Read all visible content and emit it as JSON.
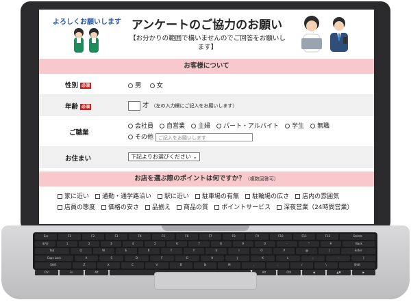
{
  "header": {
    "tagline": "よろしくお願いします",
    "title": "アンケートのご協力のお願い",
    "subtitle": "【お分かりの範囲で構いませんのでご回答をお願いします】"
  },
  "section_customer": {
    "title": "お客様について"
  },
  "gender": {
    "label": "性別",
    "required": "必須",
    "options": [
      "男",
      "女"
    ]
  },
  "age": {
    "label": "年齢",
    "required": "必須",
    "unit": "才",
    "note": "（左の入力欄にご記入をお願いします）"
  },
  "occupation": {
    "label": "ご職業",
    "options": [
      "会社員",
      "自営業",
      "主婦",
      "パート・アルバイト",
      "学生",
      "無職"
    ],
    "other_label": "その他",
    "other_placeholder": "ご記入をお願いします"
  },
  "address": {
    "label": "お住まい",
    "select_value": "下記よりお選びください"
  },
  "section_points": {
    "title": "お店を選ぶ際のポイントは何ですか？",
    "note": "（複数回答可）"
  },
  "points": {
    "row1": [
      "家に近い",
      "通勤・通学路沿い",
      "駅に近い",
      "駐車場の有無",
      "駐輪場の広さ",
      "店内の雰囲気"
    ],
    "row2": [
      "店員の態度",
      "価格の安さ",
      "品揃え",
      "商品の質",
      "ポイントサービス",
      "深夜営業（24時間営業）"
    ]
  },
  "keyboard": {
    "row1": [
      "Esc",
      "F1",
      "F2",
      "F3",
      "F4",
      "F5",
      "F6",
      "F7",
      "F8",
      "F9",
      "F10",
      "F11",
      "F12",
      "Delete"
    ],
    "row2": [
      "半/全",
      "1",
      "2",
      "3",
      "4",
      "5",
      "6",
      "7",
      "8",
      "9",
      "0",
      "-",
      "^",
      "¥",
      "Back"
    ],
    "row3": [
      "Tab",
      "Q",
      "W",
      "E",
      "R",
      "T",
      "Y",
      "U",
      "I",
      "O",
      "P",
      "@",
      "[",
      "Enter"
    ],
    "row4": [
      "Caps Lock",
      "A",
      "S",
      "D",
      "F",
      "G",
      "H",
      "J",
      "K",
      "L",
      ";",
      ":",
      "]"
    ],
    "row5": [
      "Shift",
      "Z",
      "X",
      "C",
      "V",
      "B",
      "N",
      "M",
      ",",
      ".",
      "/",
      "\\",
      "Shift"
    ],
    "row6": [
      "Ctrl",
      "Fn",
      "Alt",
      "",
      "Alt",
      "Ctrl",
      "◀",
      "▲▼",
      "▶"
    ]
  },
  "colors": {
    "section_bar": "#f8c9cc",
    "required_badge": "#d11a1a",
    "tagline": "#2d5fa8"
  }
}
